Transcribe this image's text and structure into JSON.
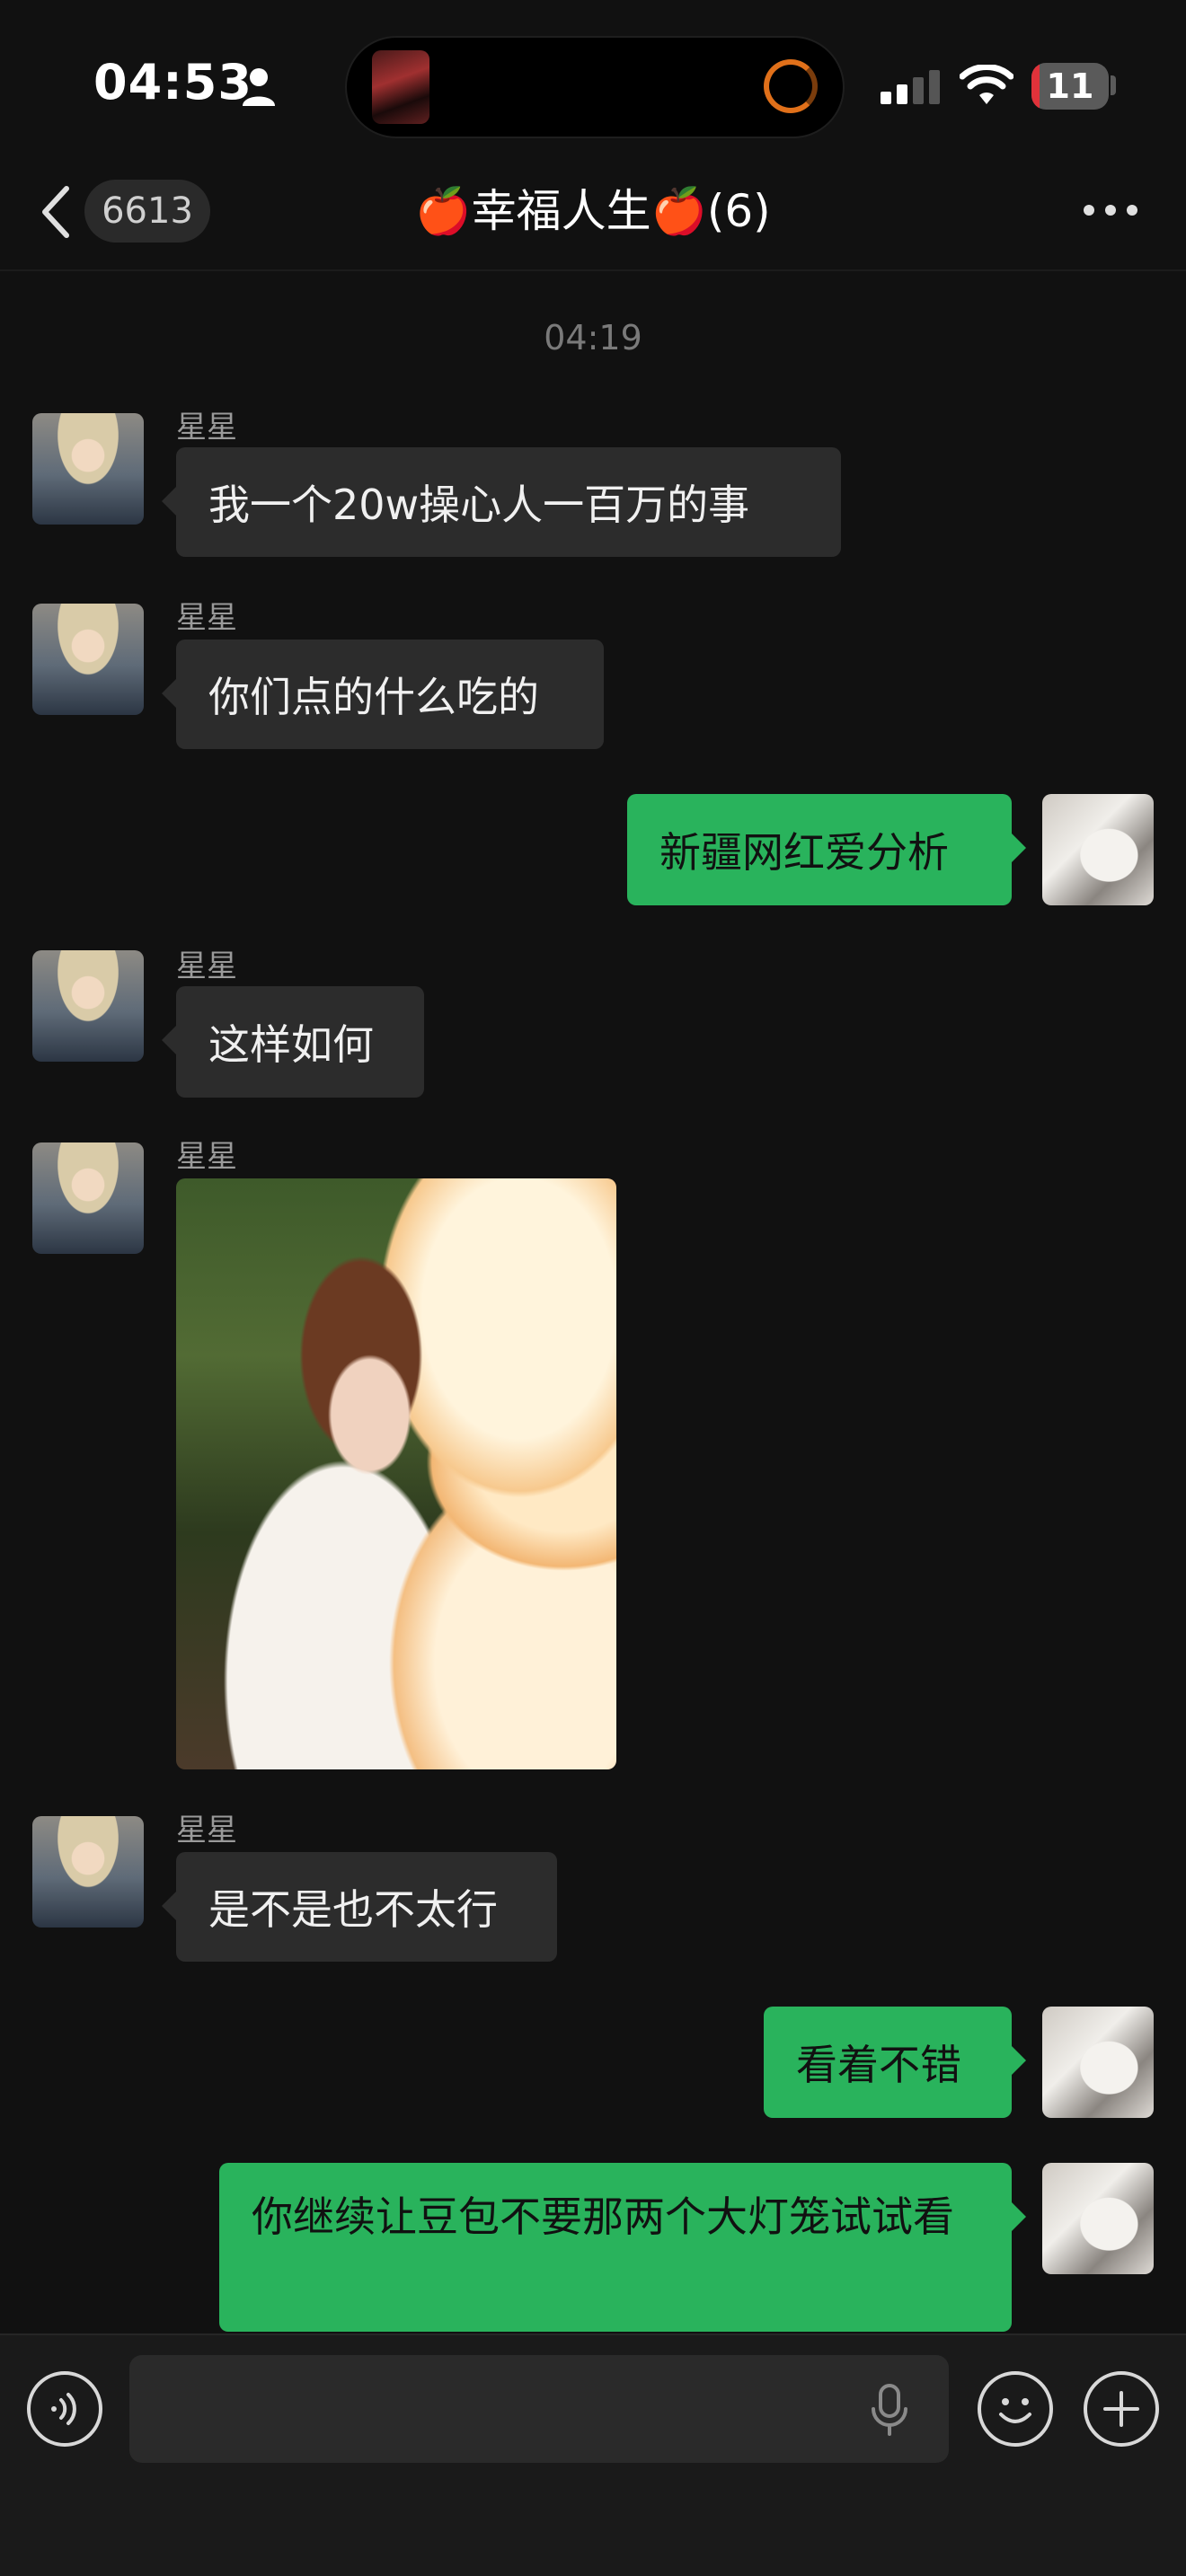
{
  "status_bar": {
    "time": "04:53",
    "battery_level": "11",
    "battery_fraction": 0.11
  },
  "header": {
    "back_count": "6613",
    "title": "🍎幸福人生🍎(6)"
  },
  "time_divider": "04:19",
  "messages": [
    {
      "side": "left",
      "sender": "星星",
      "type": "text",
      "text": "我一个20w操心人一百万的事"
    },
    {
      "side": "left",
      "sender": "星星",
      "type": "text",
      "text": "你们点的什么吃的"
    },
    {
      "side": "right",
      "type": "text",
      "text": "新疆网红爱分析"
    },
    {
      "side": "left",
      "sender": "星星",
      "type": "text",
      "text": "这样如何"
    },
    {
      "side": "left",
      "sender": "星星",
      "type": "image",
      "text": ""
    },
    {
      "side": "left",
      "sender": "星星",
      "type": "text",
      "text": "是不是也不太行"
    },
    {
      "side": "right",
      "type": "text",
      "text": "看着不错"
    },
    {
      "side": "right",
      "type": "text",
      "text": "你继续让豆包不要那两个大灯笼试试看"
    }
  ],
  "input_bar": {
    "value": "",
    "placeholder": ""
  },
  "colors": {
    "background": "#111111",
    "bubble_incoming": "#2c2c2c",
    "bubble_outgoing": "#29b35c",
    "battery_low": "#e0323a"
  },
  "icons": [
    "person-icon",
    "signal-icon",
    "wifi-icon",
    "battery-icon",
    "back-icon",
    "more-icon",
    "voice-icon",
    "mic-icon",
    "emoji-icon",
    "plus-icon"
  ]
}
